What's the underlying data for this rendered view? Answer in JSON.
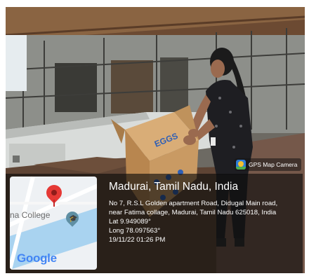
{
  "badge": {
    "label": "GPS Map Camera",
    "icon": "gps-map-camera-icon"
  },
  "map": {
    "label": "na College",
    "logo": "Google",
    "icons": [
      "map-pin-icon",
      "school-icon"
    ]
  },
  "location": {
    "place": "Madurai, Tamil Nadu, India",
    "address_line1": "No 7, R.S.L Golden apartment Road, Didugal Main road,",
    "address_line2": "near Fatima collage, Madurai, Tamil Nadu 625018, India",
    "lat": "Lat 9.949089°",
    "long": "Long 78.097563°",
    "datetime": "19/11/22 01:26 PM"
  },
  "photo": {
    "box_label": "EGGS",
    "colors": {
      "wall": "#c9ccc9",
      "box": "#c99a63",
      "soil": "#5e4434",
      "dress": "#1e1e22"
    }
  }
}
